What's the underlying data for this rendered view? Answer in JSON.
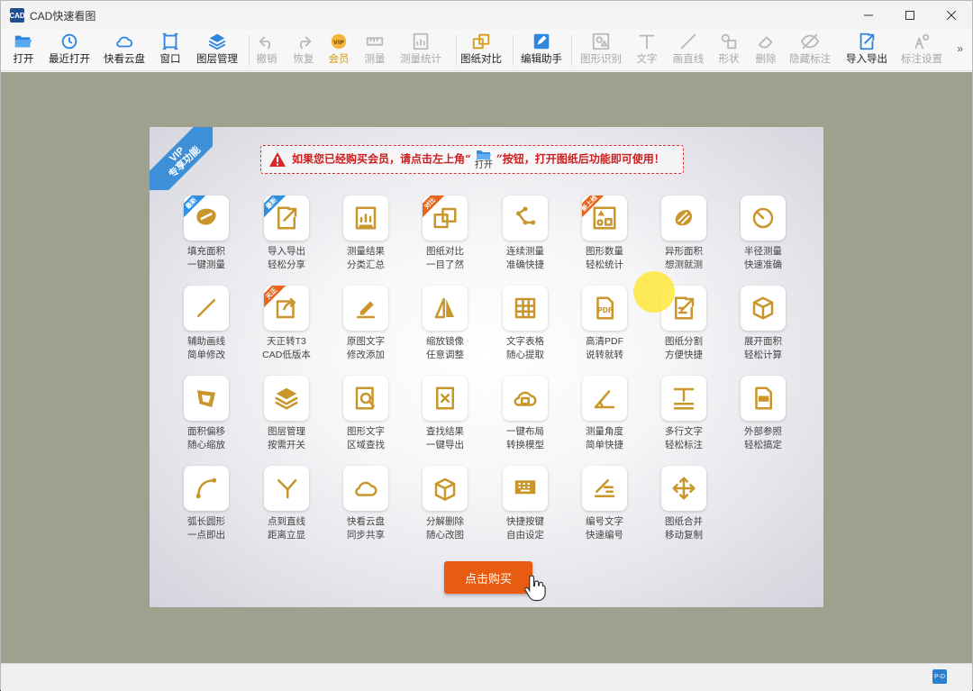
{
  "window": {
    "title": "CAD快速看图",
    "logo_text": "CAD"
  },
  "toolbar": {
    "items": [
      {
        "label": "打开",
        "icon": "folder-open-icon",
        "state": "normal"
      },
      {
        "label": "最近打开",
        "icon": "clock-icon",
        "state": "normal"
      },
      {
        "label": "快看云盘",
        "icon": "cloud-icon",
        "state": "normal"
      },
      {
        "label": "窗口",
        "icon": "window-icon",
        "state": "normal"
      },
      {
        "label": "图层管理",
        "icon": "layers-icon",
        "state": "normal"
      },
      {
        "label": "撤销",
        "icon": "undo-icon",
        "state": "disabled"
      },
      {
        "label": "恢复",
        "icon": "redo-icon",
        "state": "disabled"
      },
      {
        "label": "会员",
        "icon": "vip-icon",
        "state": "active"
      },
      {
        "label": "测量",
        "icon": "ruler-icon",
        "state": "disabled"
      },
      {
        "label": "测量统计",
        "icon": "measure-stats-icon",
        "state": "disabled"
      },
      {
        "label": "图纸对比",
        "icon": "compare-icon",
        "state": "normal"
      },
      {
        "label": "编辑助手",
        "icon": "edit-helper-icon",
        "state": "normal"
      },
      {
        "label": "图形识别",
        "icon": "shape-recognize-icon",
        "state": "disabled"
      },
      {
        "label": "文字",
        "icon": "text-icon",
        "state": "disabled"
      },
      {
        "label": "画直线",
        "icon": "line-icon",
        "state": "disabled"
      },
      {
        "label": "形状",
        "icon": "shape-icon",
        "state": "disabled"
      },
      {
        "label": "删除",
        "icon": "eraser-icon",
        "state": "disabled"
      },
      {
        "label": "隐藏标注",
        "icon": "hide-icon",
        "state": "disabled"
      },
      {
        "label": "导入导出",
        "icon": "import-export-icon",
        "state": "normal"
      },
      {
        "label": "标注设置",
        "icon": "annotation-settings-icon",
        "state": "disabled"
      }
    ],
    "more": "»"
  },
  "panel": {
    "ribbon": {
      "line1": "VIP",
      "line2": "专享功能"
    },
    "notice": {
      "before": "如果您已经购买会员，请点击左上角“",
      "open_label": "打开",
      "after": "”按钮，打开图纸后功能即可使用！"
    },
    "features": [
      {
        "line1": "填充面积",
        "line2": "一键测量",
        "tag": "最新",
        "tag_color": "blue",
        "icon": "area-fill-icon"
      },
      {
        "line1": "导入导出",
        "line2": "轻松分享",
        "tag": "最新",
        "tag_color": "blue",
        "icon": "import-export-icon"
      },
      {
        "line1": "测量结果",
        "line2": "分类汇总",
        "tag": "",
        "tag_color": "",
        "icon": "measure-summary-icon"
      },
      {
        "line1": "图纸对比",
        "line2": "一目了然",
        "tag": "对比",
        "tag_color": "orange",
        "icon": "compare-icon"
      },
      {
        "line1": "连续测量",
        "line2": "准确快捷",
        "tag": "",
        "tag_color": "",
        "icon": "continuous-measure-icon"
      },
      {
        "line1": "图形数量",
        "line2": "轻松统计",
        "tag": "新上线",
        "tag_color": "orange",
        "icon": "shape-count-icon"
      },
      {
        "line1": "异形面积",
        "line2": "想测就测",
        "tag": "",
        "tag_color": "",
        "icon": "irregular-area-icon"
      },
      {
        "line1": "半径测量",
        "line2": "快速准确",
        "tag": "",
        "tag_color": "",
        "icon": "radius-icon"
      },
      {
        "line1": "辅助画线",
        "line2": "简单修改",
        "tag": "",
        "tag_color": "",
        "icon": "draw-line-icon"
      },
      {
        "line1": "天正转T3",
        "line2": "CAD低版本",
        "tag": "天正",
        "tag_color": "orange",
        "icon": "convert-icon"
      },
      {
        "line1": "原图文字",
        "line2": "修改添加",
        "tag": "",
        "tag_color": "",
        "icon": "text-edit-icon"
      },
      {
        "line1": "缩放镜像",
        "line2": "任意调整",
        "tag": "",
        "tag_color": "",
        "icon": "mirror-icon"
      },
      {
        "line1": "文字表格",
        "line2": "随心提取",
        "tag": "",
        "tag_color": "",
        "icon": "table-extract-icon"
      },
      {
        "line1": "高清PDF",
        "line2": "说转就转",
        "tag": "",
        "tag_color": "",
        "icon": "pdf-icon"
      },
      {
        "line1": "图纸分割",
        "line2": "方便快捷",
        "tag": "",
        "tag_color": "",
        "icon": "split-icon"
      },
      {
        "line1": "展开面积",
        "line2": "轻松计算",
        "tag": "",
        "tag_color": "",
        "icon": "cube-icon"
      },
      {
        "line1": "面积偏移",
        "line2": "随心缩放",
        "tag": "",
        "tag_color": "",
        "icon": "area-offset-icon"
      },
      {
        "line1": "图层管理",
        "line2": "按需开关",
        "tag": "",
        "tag_color": "",
        "icon": "layers-icon"
      },
      {
        "line1": "图形文字",
        "line2": "区域查找",
        "tag": "",
        "tag_color": "",
        "icon": "search-area-icon"
      },
      {
        "line1": "查找结果",
        "line2": "一键导出",
        "tag": "",
        "tag_color": "",
        "icon": "export-result-icon"
      },
      {
        "line1": "一键布局",
        "line2": "转换模型",
        "tag": "",
        "tag_color": "",
        "icon": "layout-icon"
      },
      {
        "line1": "测量角度",
        "line2": "简单快捷",
        "tag": "",
        "tag_color": "",
        "icon": "angle-icon"
      },
      {
        "line1": "多行文字",
        "line2": "轻松标注",
        "tag": "",
        "tag_color": "",
        "icon": "multiline-text-icon"
      },
      {
        "line1": "外部参照",
        "line2": "轻松搞定",
        "tag": "",
        "tag_color": "",
        "icon": "xref-icon"
      },
      {
        "line1": "弧长圆形",
        "line2": "一点即出",
        "tag": "",
        "tag_color": "",
        "icon": "arc-icon"
      },
      {
        "line1": "点到直线",
        "line2": "距离立显",
        "tag": "",
        "tag_color": "",
        "icon": "point-line-icon"
      },
      {
        "line1": "快看云盘",
        "line2": "同步共享",
        "tag": "",
        "tag_color": "",
        "icon": "cloud-icon"
      },
      {
        "line1": "分解删除",
        "line2": "随心改图",
        "tag": "",
        "tag_color": "",
        "icon": "explode-icon"
      },
      {
        "line1": "快捷按键",
        "line2": "自由设定",
        "tag": "",
        "tag_color": "",
        "icon": "keyboard-icon"
      },
      {
        "line1": "编号文字",
        "line2": "快速编号",
        "tag": "",
        "tag_color": "",
        "icon": "numbering-icon"
      },
      {
        "line1": "图纸合并",
        "line2": "移动复制",
        "tag": "",
        "tag_color": "",
        "icon": "merge-move-icon"
      }
    ],
    "buy_button": "点击购买"
  },
  "status": {
    "icon_text": "P-D"
  },
  "colors": {
    "workspace": "#9fa18f",
    "icon_gold": "#c9962b",
    "buy_orange": "#e85c12",
    "vip_blue": "#3d8fd8",
    "notice_red": "#cc1f1f"
  }
}
